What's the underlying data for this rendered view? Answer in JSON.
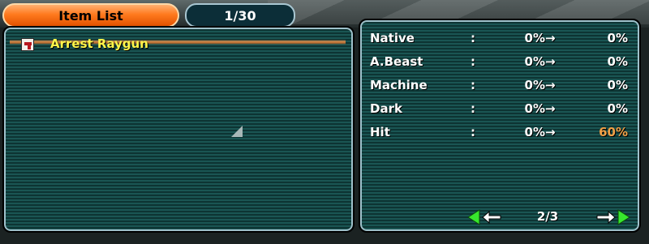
{
  "tabs": {
    "active_label": "Item List",
    "counter": "1/30"
  },
  "items": [
    {
      "name": "Arrest Raygun",
      "icon": "handgun-icon"
    }
  ],
  "stats": [
    {
      "label": "Native",
      "colon": ":",
      "from": "0%",
      "arrow": "→",
      "to": "0%",
      "to_color": "#ffffff"
    },
    {
      "label": "A.Beast",
      "colon": ":",
      "from": "0%",
      "arrow": "→",
      "to": "0%",
      "to_color": "#ffffff"
    },
    {
      "label": "Machine",
      "colon": ":",
      "from": "0%",
      "arrow": "→",
      "to": "0%",
      "to_color": "#ffffff"
    },
    {
      "label": "Dark",
      "colon": ":",
      "from": "0%",
      "arrow": "→",
      "to": "0%",
      "to_color": "#ffffff"
    },
    {
      "label": "Hit",
      "colon": ":",
      "from": "0%",
      "arrow": "→",
      "to": "60%",
      "to_color": "#f0a047"
    }
  ],
  "pagination": {
    "page": "2/3",
    "prev_icon": "arrow-left-icon",
    "next_icon": "arrow-right-icon"
  },
  "colors": {
    "tab_active": "#ff7a1e",
    "item_highlight": "#fff64a",
    "panel_border": "#9fc1cb",
    "nav_green": "#37e62d"
  }
}
